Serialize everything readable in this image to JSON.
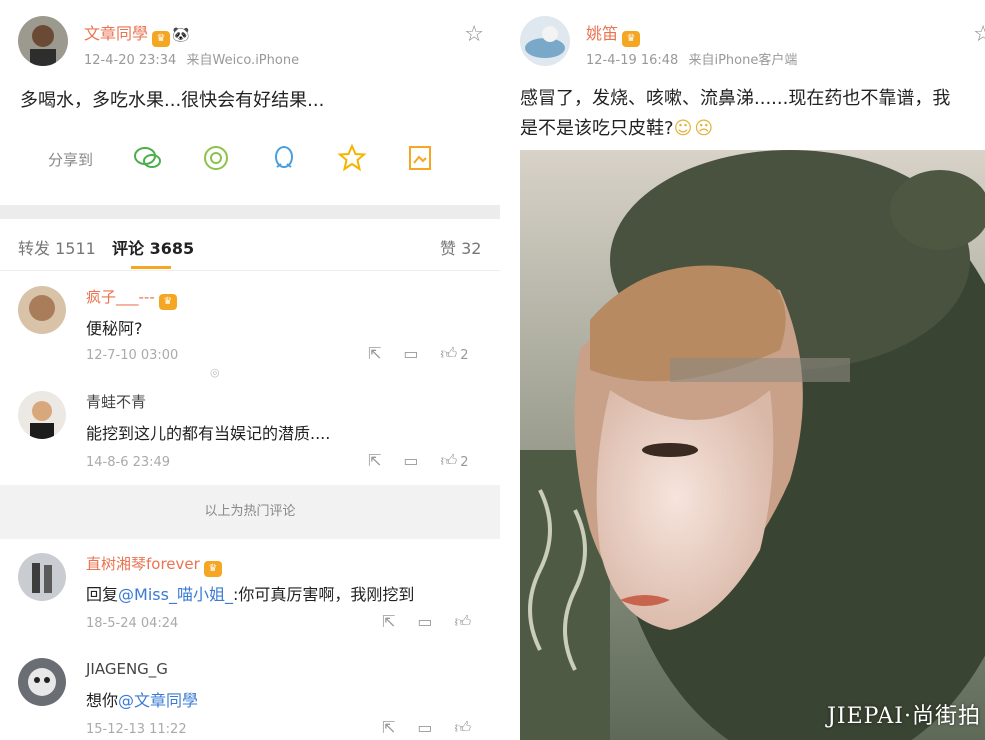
{
  "left_post": {
    "user_name": "文章同學",
    "time": "12-4-20 23:34",
    "source": "来自Weico.iPhone",
    "text": "多喝水，多吃水果...很快会有好结果...",
    "share_label": "分享到",
    "share_icons": [
      "wechat-icon",
      "moments-icon",
      "qq-icon",
      "favorite-star-icon",
      "save-image-icon"
    ]
  },
  "tabs": {
    "repost": "转发 1511",
    "comment": "评论 3685",
    "like": "赞 32"
  },
  "comments": [
    {
      "name": "疯子___---",
      "text": "便秘阿?",
      "time": "12-7-10 03:00",
      "likes": "2"
    },
    {
      "name": "青蛙不青",
      "text": "能挖到这儿的都有当娱记的潜质....",
      "time": "14-8-6 23:49",
      "likes": "2"
    },
    {
      "name": "直树湘琴forever",
      "text_prefix": "回复",
      "mention": "@Miss_喵小姐_",
      "text_suffix": ":你可真厉害啊，我刚挖到",
      "time": "18-5-24 04:24",
      "likes": ""
    },
    {
      "name": "JIAGENG_G",
      "text_prefix": "想你",
      "mention": "@文章同學",
      "text_suffix": "",
      "time": "15-12-13 11:22",
      "likes": ""
    }
  ],
  "hot_divider": "以上为热门评论",
  "right_post": {
    "user_name": "姚笛",
    "time": "12-4-19 16:48",
    "source": "来自iPhone客户端",
    "text_line1": "感冒了，发烧、咳嗽、流鼻涕......现在药也不靠谱，我",
    "text_line2": "是不是该吃只皮鞋?"
  },
  "brand": "JIEPAI·尚街拍",
  "colors": {
    "name": "#eb7350",
    "mention": "#3b7bd4",
    "accent": "#f5a623"
  }
}
